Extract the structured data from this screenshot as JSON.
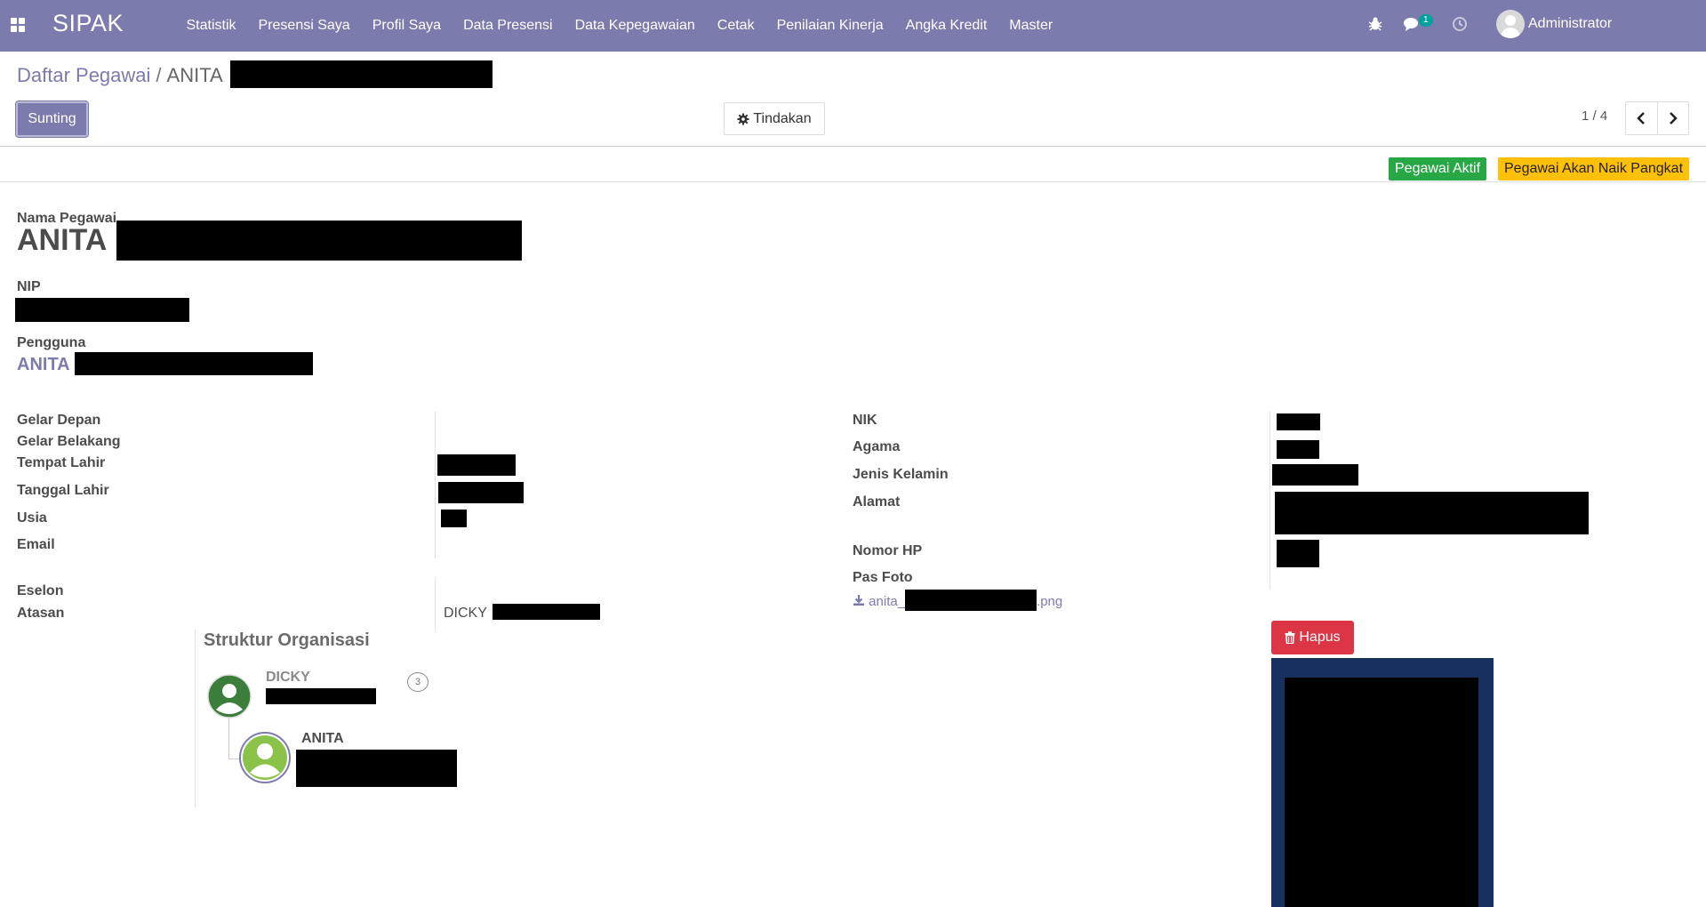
{
  "navbar": {
    "brand": "SIPAK",
    "menu": [
      "Statistik",
      "Presensi Saya",
      "Profil Saya",
      "Data Presensi",
      "Data Kepegawaian",
      "Cetak",
      "Penilaian Kinerja",
      "Angka Kredit",
      "Master"
    ],
    "chat_badge": "1",
    "user": "Administrator"
  },
  "control_panel": {
    "breadcrumb_parent": "Daftar Pegawai",
    "breadcrumb_separator": "/",
    "breadcrumb_current": "ANITA",
    "edit_button": "Sunting",
    "action_button": "Tindakan",
    "pager": "1 / 4"
  },
  "status": {
    "tag_active": "Pegawai Aktif",
    "tag_promotion": "Pegawai Akan Naik Pangkat"
  },
  "form": {
    "nama_label": "Nama Pegawai",
    "nama_value": "ANITA",
    "nip_label": "NIP",
    "pengguna_label": "Pengguna",
    "pengguna_value": "ANITA",
    "left_labels": {
      "gelar_depan": "Gelar Depan",
      "gelar_belakang": "Gelar Belakang",
      "tempat_lahir": "Tempat Lahir",
      "tanggal_lahir": "Tanggal Lahir",
      "usia": "Usia",
      "email": "Email",
      "eselon": "Eselon",
      "atasan": "Atasan"
    },
    "atasan_value": "DICKY",
    "right_labels": {
      "nik": "NIK",
      "agama": "Agama",
      "jenis_kelamin": "Jenis Kelamin",
      "alamat": "Alamat",
      "nomor_hp": "Nomor HP",
      "pas_foto": "Pas Foto"
    },
    "pas_foto_prefix": "anita_",
    "pas_foto_suffix": ".png",
    "delete_button": "Hapus"
  },
  "org": {
    "title": "Struktur Organisasi",
    "manager_name": "DICKY",
    "manager_count": "3",
    "employee_name": "ANITA"
  }
}
